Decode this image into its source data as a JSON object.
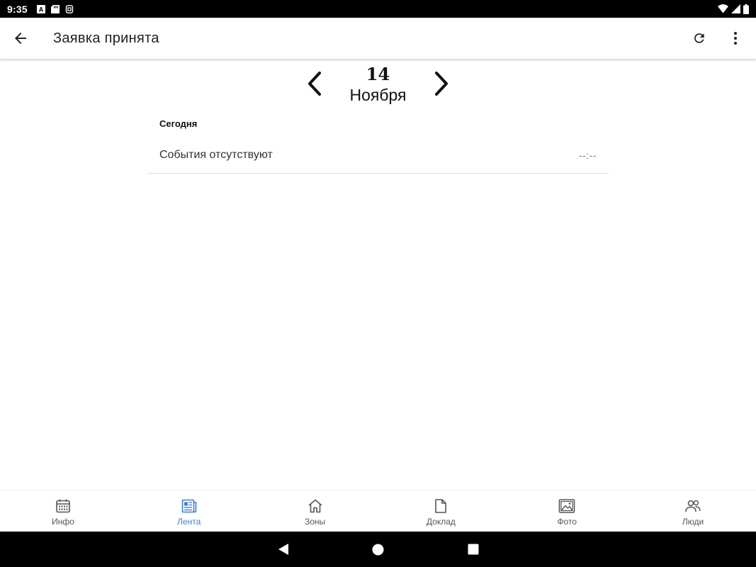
{
  "status_bar": {
    "time": "9:35",
    "left_icons": [
      "a-badge-icon",
      "sd-card-icon",
      "sim-icon"
    ],
    "right_icons": [
      "wifi-icon",
      "signal-icon",
      "battery-icon"
    ]
  },
  "app_bar": {
    "title": "Заявка принята",
    "back_icon": "arrow-back-icon",
    "refresh_icon": "refresh-icon",
    "menu_icon": "more-vert-icon"
  },
  "date_nav": {
    "day": "14",
    "month": "Ноября",
    "prev_icon": "chevron-left-icon",
    "next_icon": "chevron-right-icon"
  },
  "section": {
    "header": "Сегодня",
    "events": [
      {
        "title": "События отсутствуют",
        "time": "--:--"
      }
    ]
  },
  "bottom_nav": {
    "items": [
      {
        "label": "Инфо",
        "icon": "calendar-icon",
        "active": false
      },
      {
        "label": "Лента",
        "icon": "newspaper-icon",
        "active": true
      },
      {
        "label": "Зоны",
        "icon": "home-icon",
        "active": false
      },
      {
        "label": "Доклад",
        "icon": "document-icon",
        "active": false
      },
      {
        "label": "Фото",
        "icon": "photo-icon",
        "active": false
      },
      {
        "label": "Люди",
        "icon": "people-icon",
        "active": false
      }
    ],
    "active_color": "#3a7de0",
    "inactive_color": "#555555"
  },
  "system_nav": {
    "buttons": [
      "back-triangle-icon",
      "home-circle-icon",
      "recents-square-icon"
    ]
  }
}
